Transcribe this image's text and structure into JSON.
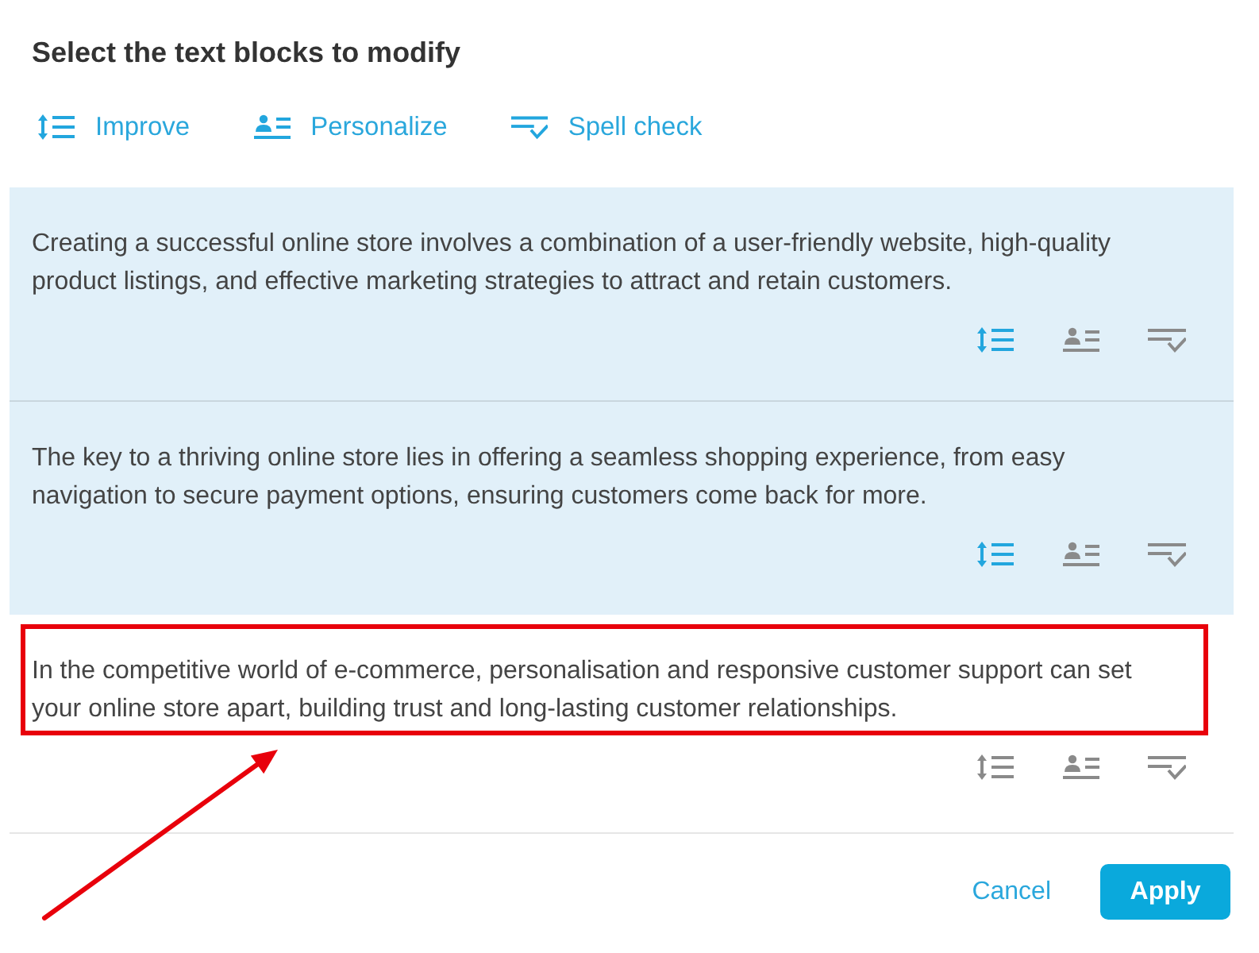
{
  "title": "Select the text blocks to modify",
  "actions": [
    {
      "kind": "improve",
      "label": "Improve"
    },
    {
      "kind": "personalize",
      "label": "Personalize"
    },
    {
      "kind": "spellcheck",
      "label": "Spell check"
    }
  ],
  "blocks": [
    {
      "text": "Creating a successful online store involves a combination of a user-friendly website, high-quality product listings, and effective marketing strategies to attract and retain customers.",
      "selected": true,
      "highlighted": false
    },
    {
      "text": "The key to a thriving online store lies in offering a seamless shopping experience, from easy navigation to secure payment options, ensuring customers come back for more.",
      "selected": true,
      "highlighted": false
    },
    {
      "text": "In the competitive world of e-commerce, personalisation and responsive customer support can set your online store apart, building trust and long-lasting customer relationships.",
      "selected": false,
      "highlighted": true
    }
  ],
  "buttons": [
    {
      "kind": "secondary",
      "label": "Cancel"
    },
    {
      "kind": "primary",
      "label": "Apply"
    }
  ]
}
